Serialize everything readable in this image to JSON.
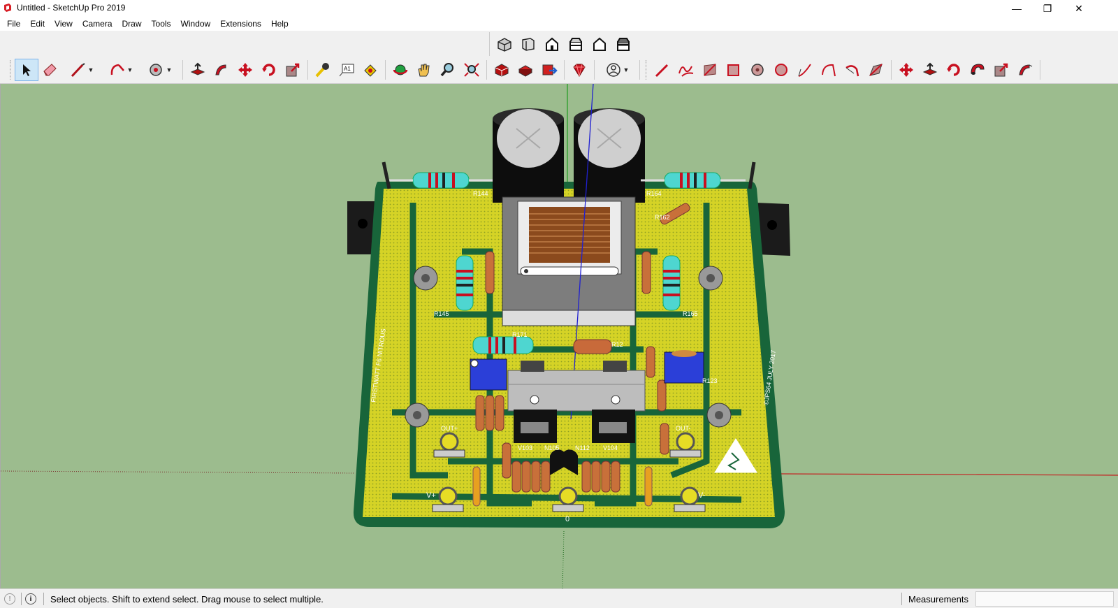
{
  "window": {
    "title": "Untitled - SketchUp Pro 2019",
    "minimize": "—",
    "restore": "❐",
    "close": "✕"
  },
  "menu": [
    "File",
    "Edit",
    "View",
    "Camera",
    "Draw",
    "Tools",
    "Window",
    "Extensions",
    "Help"
  ],
  "toolbar_icons": {
    "views": [
      "iso-view-icon",
      "top-view-icon",
      "front-view-icon",
      "right-view-icon",
      "back-view-icon",
      "left-view-icon"
    ],
    "main": [
      "select-icon",
      "eraser-icon",
      "line-icon",
      "arc-icon",
      "shapes-icon",
      "push-pull-icon",
      "follow-me-icon",
      "move-icon",
      "rotate-icon",
      "scale-icon",
      "tape-measure-icon",
      "text-icon",
      "paint-bucket-icon",
      "orbit-icon",
      "pan-icon",
      "zoom-icon",
      "zoom-extents-icon",
      "3d-warehouse-icon",
      "extension-warehouse-icon",
      "layout-icon",
      "ruby-icon",
      "account-icon"
    ],
    "extensions": [
      "pencil-tool-icon",
      "freehand-icon",
      "tool-3-icon",
      "tool-4-icon",
      "circle-tool-icon",
      "circle-tool-2-icon",
      "curve-tool-icon",
      "arc-tool-2-icon",
      "arc-tool-3-icon",
      "tool-10-icon",
      "move-tool-2-icon",
      "push-tool-2-icon",
      "rotate-tool-2-icon",
      "torus-tool-icon",
      "scale-tool-2-icon",
      "follow-tool-2-icon"
    ]
  },
  "board": {
    "labels": {
      "r144": "R144",
      "r164": "R164",
      "r145": "R145",
      "r165": "R165",
      "r162": "R162",
      "r171": "R171",
      "r123": "R123",
      "r12": "R12",
      "v103": "V103",
      "n105": "N105",
      "n112": "N112",
      "v104": "V104",
      "out_plus": "OUT+",
      "out_minus": "OUT-",
      "v_plus": "V+",
      "v_minus": "V-",
      "zero": "0",
      "left_text": "FIRSTWATT F6 NITROUS",
      "right_text": "©JPS64 JULY 2017"
    }
  },
  "colors": {
    "viewport_bg": "#9cbc8e",
    "pcb_yellow": "#e6dc25",
    "pcb_green": "#18653a",
    "resistor_teal": "#4ed6d0",
    "trim_blue": "#2b3fd8",
    "axis_red": "#c42020",
    "axis_green": "#1f9c1f",
    "axis_blue": "#2020d0"
  },
  "status": {
    "message": "Select objects. Shift to extend select. Drag mouse to select multiple.",
    "measurements_label": "Measurements",
    "measurements_value": ""
  }
}
